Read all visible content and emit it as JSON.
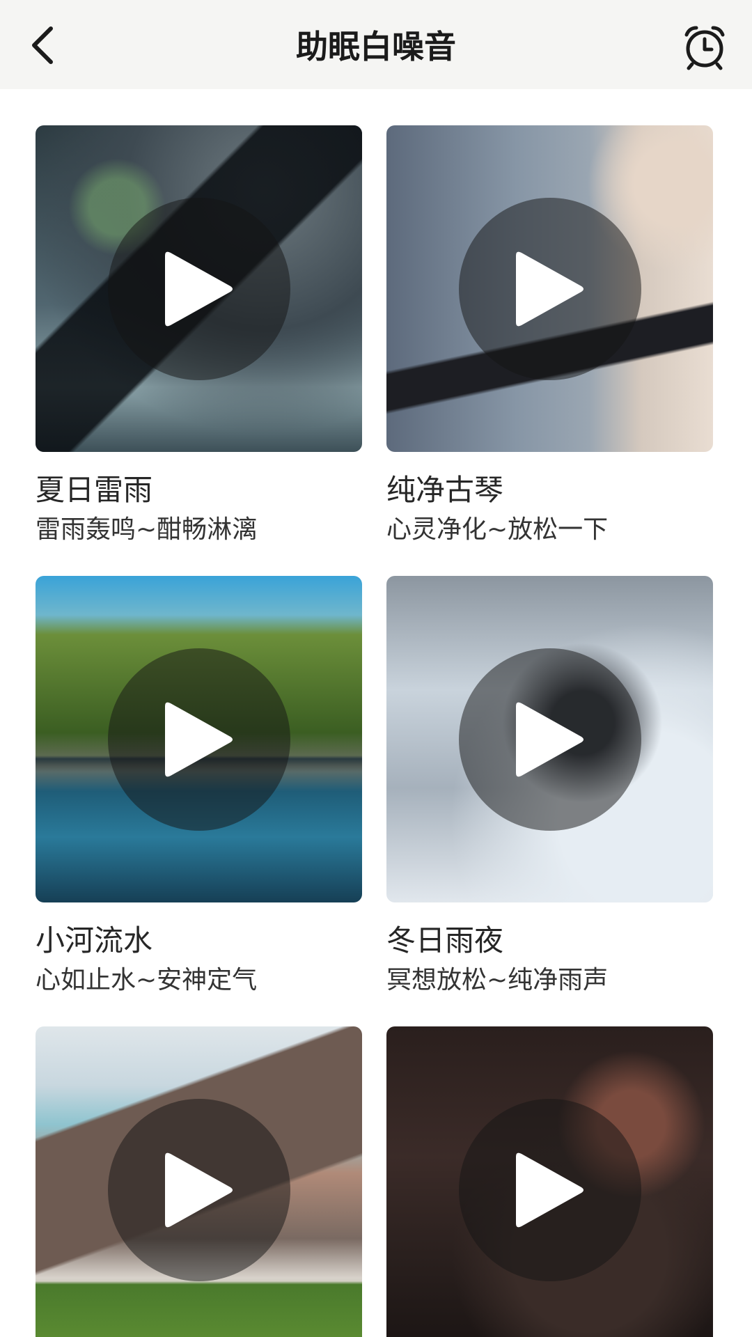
{
  "header": {
    "title": "助眠白噪音",
    "back_icon": "chevron-left-icon",
    "alarm_icon": "alarm-clock-icon"
  },
  "cards": [
    {
      "title": "夏日雷雨",
      "subtitle": "雷雨轰鸣~酣畅淋漓",
      "image": "rain-splash"
    },
    {
      "title": "纯净古琴",
      "subtitle": "心灵净化~放松一下",
      "image": "guqin-player"
    },
    {
      "title": "小河流水",
      "subtitle": "心如止水~安神定气",
      "image": "forest-river"
    },
    {
      "title": "冬日雨夜",
      "subtitle": "冥想放松~纯净雨声",
      "image": "snowflake"
    },
    {
      "title": "",
      "subtitle": "",
      "image": "mountain-meadow"
    },
    {
      "title": "",
      "subtitle": "",
      "image": "guqin-player-dark"
    }
  ],
  "colors": {
    "header_bg": "#f5f5f3",
    "page_bg": "#ffffff",
    "play_overlay": "rgba(20,20,20,0.5)",
    "text": "#262626"
  }
}
